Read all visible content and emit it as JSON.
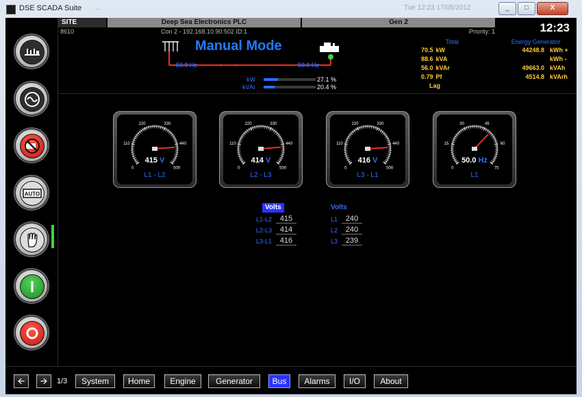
{
  "window": {
    "title": "DSE SCADA Suite",
    "ghost_left": "...",
    "ghost_right": "Tue 12:23 17/05/2012",
    "controls": [
      "_",
      "□",
      "X"
    ]
  },
  "sidebar": {
    "buttons": [
      {
        "name": "bus-mimic-icon",
        "label": "Bus"
      },
      {
        "name": "generator-icon",
        "label": "Generator"
      },
      {
        "name": "off-icon",
        "label": "Off"
      },
      {
        "name": "auto-icon",
        "label": "AUTO"
      },
      {
        "name": "hand-manual-icon",
        "label": "Manual"
      },
      {
        "name": "start-icon",
        "label": "Start"
      },
      {
        "name": "stop-icon",
        "label": "Stop"
      }
    ]
  },
  "header": {
    "site_label": "SITE",
    "site_code": "8610",
    "company": "Deep Sea Electronics PLC",
    "generator": "Gen 2",
    "connection": "Con 2 - 192.168.10.90:502 ID:1",
    "priority": "Priority:  1",
    "clock": "12:23",
    "mode": "Manual Mode",
    "bus_freq": "50.0 Hz",
    "gen_freq": "50.0 Hz",
    "bars": [
      {
        "label": "kW",
        "value": "27.1 %",
        "fraction": 0.271
      },
      {
        "label": "kVAr",
        "value": "20.4 %",
        "fraction": 0.204
      }
    ],
    "totals": {
      "heading": "Total",
      "rows": [
        {
          "value": "70.5",
          "unit": "kW"
        },
        {
          "value": "88.6",
          "unit": "kVA"
        },
        {
          "value": "56.0",
          "unit": "kVAr"
        },
        {
          "value": "0.79",
          "unit": "Pf"
        },
        {
          "value": "Lag",
          "unit": ""
        }
      ]
    },
    "energy": {
      "heading": "Energy Generator",
      "rows": [
        {
          "value": "44248.8",
          "unit": "kWh +"
        },
        {
          "value": "",
          "unit": "kWh -"
        },
        {
          "value": "49663.0",
          "unit": "kVAh"
        },
        {
          "value": "4514.8",
          "unit": "kVArh"
        }
      ]
    }
  },
  "gauges": [
    {
      "value": "415",
      "unit": "V",
      "label": "L1 - L2",
      "ticks": [
        "0",
        "110",
        "220",
        "330",
        "440",
        "500"
      ],
      "reading": 415,
      "min": 0,
      "max": 500
    },
    {
      "value": "414",
      "unit": "V",
      "label": "L2 - L3",
      "ticks": [
        "0",
        "110",
        "220",
        "330",
        "440",
        "500"
      ],
      "reading": 414,
      "min": 0,
      "max": 500
    },
    {
      "value": "416",
      "unit": "V",
      "label": "L3 - L1",
      "ticks": [
        "0",
        "110",
        "220",
        "330",
        "440",
        "500"
      ],
      "reading": 416,
      "min": 0,
      "max": 500
    },
    {
      "value": "50.0",
      "unit": "Hz",
      "label": "L1",
      "ticks": [
        "0",
        "15",
        "30",
        "45",
        "60",
        "75"
      ],
      "reading": 50.0,
      "min": 0,
      "max": 75
    }
  ],
  "volts_ll": {
    "heading": "Volts",
    "rows": [
      {
        "label": "L1-L2",
        "value": "415"
      },
      {
        "label": "L2-L3",
        "value": "414"
      },
      {
        "label": "L3-L1",
        "value": "416"
      }
    ]
  },
  "volts_ln": {
    "heading": "Volts",
    "rows": [
      {
        "label": "L1",
        "value": "240"
      },
      {
        "label": "L2",
        "value": "240"
      },
      {
        "label": "L3",
        "value": "239"
      }
    ]
  },
  "footer": {
    "page_indicator": "1/3",
    "tabs": [
      {
        "label": "System",
        "active": false
      },
      {
        "label": "Home",
        "active": false
      },
      {
        "label": "Engine",
        "active": false
      },
      {
        "label": "Generator",
        "active": false
      },
      {
        "label": "Bus",
        "active": true
      },
      {
        "label": "Alarms",
        "active": false
      },
      {
        "label": "I/O",
        "active": false
      },
      {
        "label": "About",
        "active": false
      }
    ]
  },
  "colors": {
    "accent_blue": "#1e7bff",
    "value_yellow": "#ffcc33",
    "mimic_red": "#e8321e",
    "needle_red": "#e8321e",
    "active_tab": "#2a34ff"
  }
}
